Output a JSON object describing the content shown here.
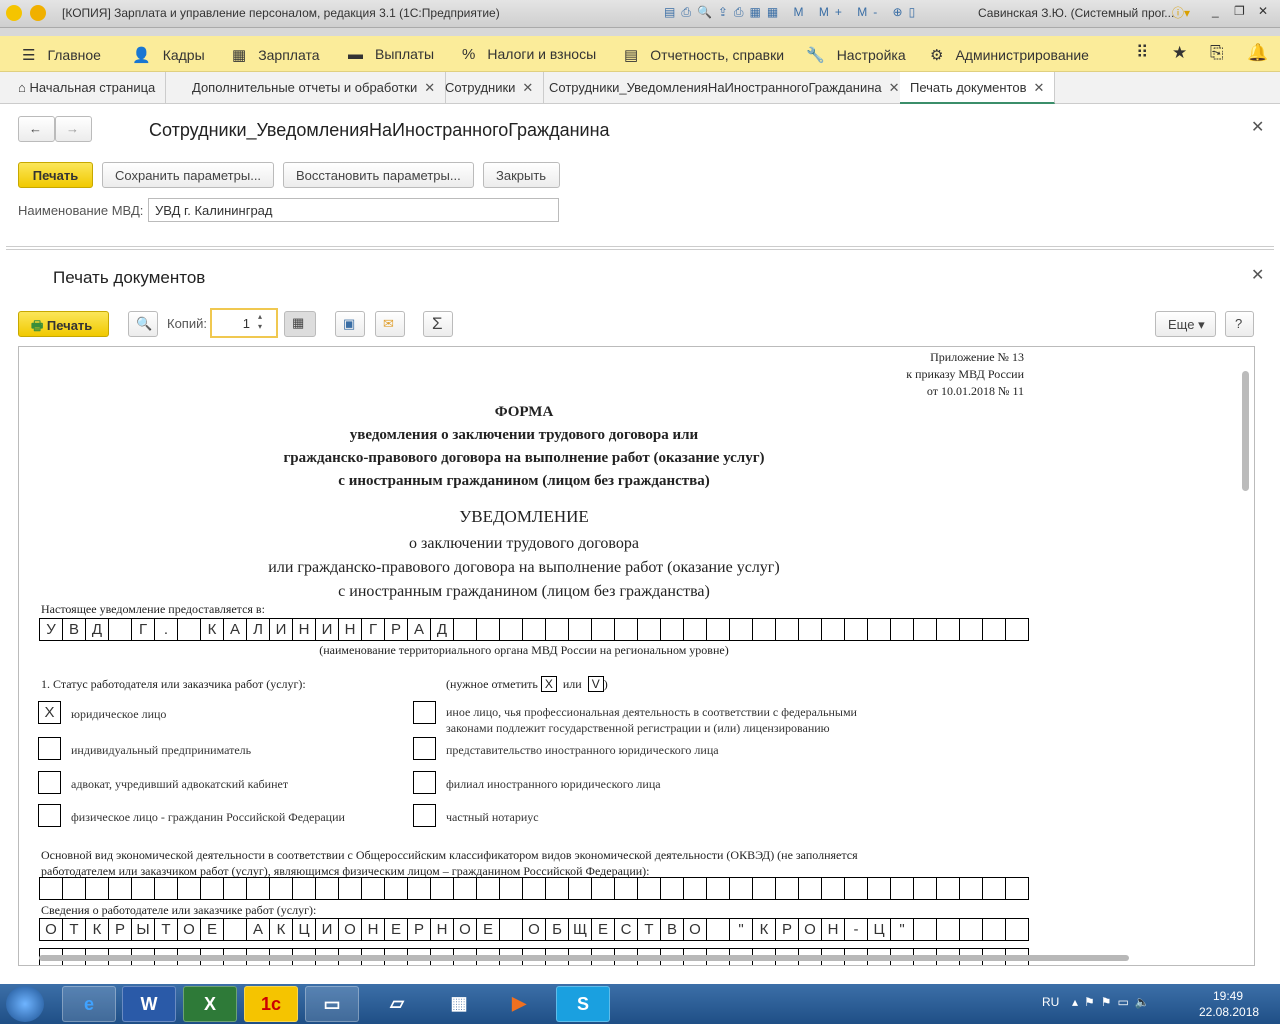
{
  "window": {
    "title": "[КОПИЯ] Зарплата и управление персоналом, редакция 3.1  (1С:Предприятие)",
    "user": "Савинская З.Ю. (Системный прог..."
  },
  "menu": [
    {
      "icon": "menu-icon",
      "label": "Главное"
    },
    {
      "icon": "people-icon",
      "label": "Кадры"
    },
    {
      "icon": "calculator-icon",
      "label": "Зарплата"
    },
    {
      "icon": "wallet-icon",
      "label": "Выплаты"
    },
    {
      "icon": "percent-icon",
      "label": "Налоги и взносы"
    },
    {
      "icon": "report-icon",
      "label": "Отчетность, справки"
    },
    {
      "icon": "wrench-icon",
      "label": "Настройка"
    },
    {
      "icon": "gear-icon",
      "label": "Администрирование"
    }
  ],
  "tabs": [
    {
      "label": "Начальная страница"
    },
    {
      "label": "Дополнительные отчеты и обработки"
    },
    {
      "label": "Сотрудники"
    },
    {
      "label": "Сотрудники_УведомленияНаИностранногоГражданина"
    },
    {
      "label": "Печать документов",
      "active": true
    }
  ],
  "form": {
    "title": "Сотрудники_УведомленияНаИностранногоГражданина",
    "print": "Печать",
    "save_params": "Сохранить параметры...",
    "restore_params": "Восстановить параметры...",
    "close": "Закрыть",
    "mvd_label": "Наименование МВД:",
    "mvd_value": "УВД г. Калининград"
  },
  "printdoc": {
    "title": "Печать документов",
    "print": "Печать",
    "copies_label": "Копий:",
    "copies": "1",
    "more": "Еще",
    "help": "?"
  },
  "document": {
    "appendix": [
      "Приложение № 13",
      "к приказу МВД России",
      "от 10.01.2018 № 11"
    ],
    "heading": [
      "ФОРМА",
      "уведомления о заключении трудового договора или",
      "гражданско-правового договора на выполнение работ (оказание услуг)",
      "с иностранным гражданином (лицом без гражданства)"
    ],
    "title": "УВЕДОМЛЕНИЕ",
    "subtitle": [
      "о заключении трудового договора",
      "или гражданско-правового договора на выполнение работ (оказание услуг)",
      "с иностранным гражданином (лицом без гражданства)"
    ],
    "submitted_to_label": "Настоящее уведомление предоставляется в:",
    "submitted_to": "УВД Г. КАЛИНИНГРАД",
    "submitted_to_caption": "(наименование территориального органа МВД России на региональном уровне)",
    "status_label": "1. Статус работодателя или заказчика работ (услуг):",
    "mark_hint": [
      "(нужное отметить",
      "X",
      "или",
      "V",
      ")"
    ],
    "status_left": [
      {
        "label": "юридическое лицо",
        "mark": "X"
      },
      {
        "label": "индивидуальный предприниматель",
        "mark": ""
      },
      {
        "label": "адвокат, учредивший адвокатский кабинет",
        "mark": ""
      },
      {
        "label": "физическое лицо - гражданин Российской Федерации",
        "mark": ""
      }
    ],
    "status_right": [
      {
        "label": "иное лицо, чья профессиональная деятельность в соответствии с федеральными",
        "label2": "законами подлежит государственной регистрации и (или) лицензированию",
        "mark": ""
      },
      {
        "label": "представительство иностранного юридического лица",
        "mark": ""
      },
      {
        "label": "филиал иностранного юридического лица",
        "mark": ""
      },
      {
        "label": "частный нотариус",
        "mark": ""
      }
    ],
    "okved_label": [
      "Основной вид экономической деятельности в соответствии с Общероссийским классификатором видов экономической деятельности (ОКВЭД) (не заполняется",
      "работодателем или заказчиком работ (услуг), являющимся физическим лицом – гражданином Российской Федерации):"
    ],
    "okved": "",
    "employer_label": "Сведения о работодателе или заказчике работ (услуг):",
    "employer": "ОТКРЫТОЕ АКЦИОНЕРНОЕ ОБЩЕСТВО \"КРОН-Ц\""
  },
  "taskbar": {
    "lang": "RU",
    "time": "19:49",
    "date": "22.08.2018"
  },
  "colors": {
    "accent": "#fbec9a",
    "button_yellow": "#f1c900",
    "tab_active": "#3b8e6a"
  }
}
